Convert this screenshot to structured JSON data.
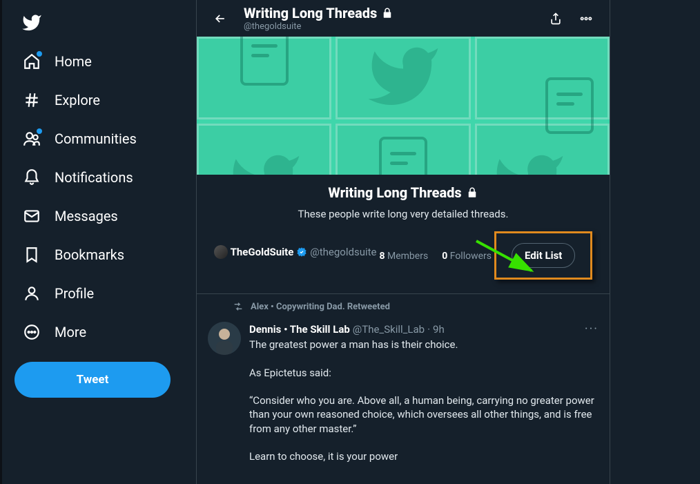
{
  "sidebar": {
    "items": [
      {
        "label": "Home",
        "icon": "home",
        "badge": true
      },
      {
        "label": "Explore",
        "icon": "hash",
        "badge": false
      },
      {
        "label": "Communities",
        "icon": "communities",
        "badge": true
      },
      {
        "label": "Notifications",
        "icon": "bell",
        "badge": false
      },
      {
        "label": "Messages",
        "icon": "mail",
        "badge": false
      },
      {
        "label": "Bookmarks",
        "icon": "bookmark",
        "badge": false
      },
      {
        "label": "Profile",
        "icon": "profile",
        "badge": false
      },
      {
        "label": "More",
        "icon": "more",
        "badge": false
      }
    ],
    "tweet_button": "Tweet"
  },
  "header": {
    "title": "Writing Long Threads",
    "subtitle": "@thegoldsuite"
  },
  "list": {
    "title": "Writing Long Threads",
    "description": "These people write long very detailed threads.",
    "owner_name": "TheGoldSuite",
    "owner_handle": "@thegoldsuite",
    "members_count": "8",
    "members_label": "Members",
    "followers_count": "0",
    "followers_label": "Followers",
    "edit_button": "Edit List"
  },
  "feed": {
    "retweet_label": "Alex • Copywriting Dad. Retweeted",
    "tweet": {
      "author_name": "Dennis • The Skill Lab",
      "author_handle": "@The_Skill_Lab",
      "time": "9h",
      "text": "The greatest power a man has is their choice.\n\nAs Epictetus said:\n\n“Consider who you are. Above all, a human being, carrying no greater power than your own reasoned choice, which oversees all other things, and is free from any other master.”\n\nLearn to choose, it is your power"
    }
  }
}
